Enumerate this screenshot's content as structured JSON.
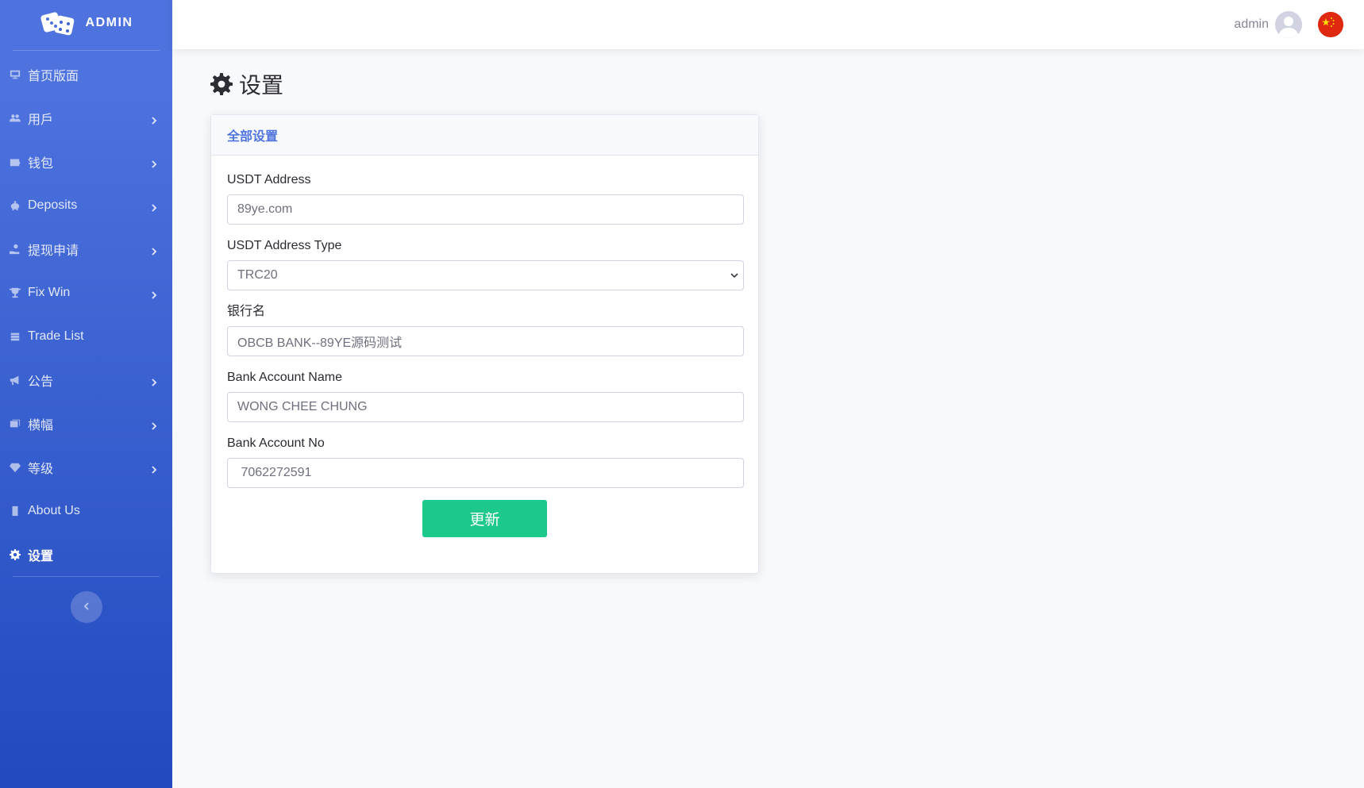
{
  "brand": {
    "title": "ADMIN",
    "icon": "dice-icon"
  },
  "sidebar": {
    "items": [
      {
        "label": "首页版面",
        "icon": "desktop-icon",
        "has_submenu": false,
        "active": false
      },
      {
        "label": "用戶",
        "icon": "users-icon",
        "has_submenu": true,
        "active": false
      },
      {
        "label": "钱包",
        "icon": "wallet-icon",
        "has_submenu": true,
        "active": false
      },
      {
        "label": "Deposits",
        "icon": "piggy-bank-icon",
        "has_submenu": true,
        "active": false
      },
      {
        "label": "提现申请",
        "icon": "hand-money-icon",
        "has_submenu": true,
        "active": false
      },
      {
        "label": "Fix Win",
        "icon": "trophy-icon",
        "has_submenu": true,
        "active": false
      },
      {
        "label": "Trade List",
        "icon": "layers-icon",
        "has_submenu": false,
        "active": false
      },
      {
        "label": "公告",
        "icon": "megaphone-icon",
        "has_submenu": true,
        "active": false
      },
      {
        "label": "横幅",
        "icon": "images-icon",
        "has_submenu": true,
        "active": false
      },
      {
        "label": "等级",
        "icon": "gem-icon",
        "has_submenu": true,
        "active": false
      },
      {
        "label": "About Us",
        "icon": "building-icon",
        "has_submenu": false,
        "active": false
      },
      {
        "label": "设置",
        "icon": "gear-icon",
        "has_submenu": false,
        "active": true
      }
    ]
  },
  "topbar": {
    "user_name": "admin"
  },
  "page": {
    "title": "设置"
  },
  "card": {
    "header": "全部设置",
    "fields": {
      "usdt_address": {
        "label": "USDT Address",
        "value": "89ye.com"
      },
      "usdt_type": {
        "label": "USDT Address Type",
        "value": "TRC20"
      },
      "bank_name": {
        "label": "银行名",
        "value": "OBCB BANK--89YE源码测试"
      },
      "account_name": {
        "label": "Bank Account Name",
        "value": "WONG CHEE CHUNG"
      },
      "account_no": {
        "label": "Bank Account No",
        "value": " 7062272591"
      }
    },
    "submit_label": "更新"
  },
  "colors": {
    "primary": "#4e73df",
    "success": "#1cc88a",
    "sidebar_end": "#224abe"
  }
}
